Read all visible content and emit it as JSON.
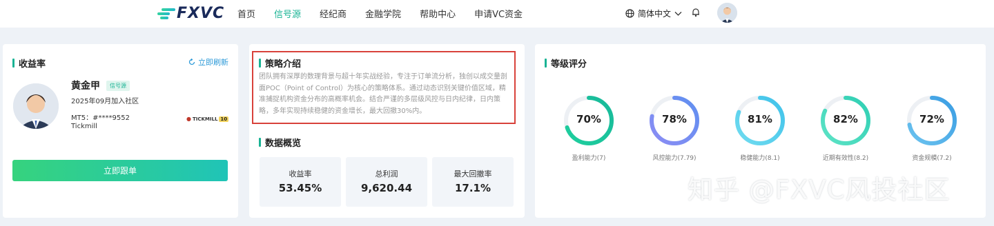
{
  "header": {
    "logo_text": "FXVC",
    "nav": [
      "首页",
      "信号源",
      "经纪商",
      "金融学院",
      "帮助中心",
      "申请VC资金"
    ],
    "active_nav": 1,
    "language": "简体中文",
    "accent": "#19b394"
  },
  "profile": {
    "section_title": "收益率",
    "refresh_label": "立即刷新",
    "name": "黄金甲",
    "badge": "信号源",
    "joined": "2025年09月加入社区",
    "mt5": "MT5：#****9552",
    "broker": "Tickmill",
    "broker_logo_text": "TICKMILL",
    "broker_logo_badge": "10",
    "follow_button": "立即跟单"
  },
  "strategy": {
    "title": "策略介绍",
    "description": "团队拥有深厚的数理背景与超十年实战经验，专注于订单流分析，独创以成交量剖面POC（Point of Control）为核心的策略体系。通过动态识别关键价值区域，精准捕捉机构资金分布的高概率机会。结合严谨的多层级风控与日内纪律，日内策略，多年实现持续稳健的资金增长，最大回撤30%内。"
  },
  "overview": {
    "title": "数据概览",
    "kpis": [
      {
        "label": "收益率",
        "value": "53.45%"
      },
      {
        "label": "总利润",
        "value": "9,620.44"
      },
      {
        "label": "最大回撤率",
        "value": "17.1%"
      }
    ]
  },
  "rating": {
    "title": "等级评分",
    "items": [
      {
        "percent": 70,
        "percent_text": "70%",
        "label": "盈利能力(7)",
        "colors": [
          "#1fcf9e",
          "#18b99a"
        ]
      },
      {
        "percent": 78,
        "percent_text": "78%",
        "label": "风控能力(7.79)",
        "colors": [
          "#8c8df4",
          "#5f8ff0"
        ]
      },
      {
        "percent": 81,
        "percent_text": "81%",
        "label": "稳健能力(8.1)",
        "colors": [
          "#71dcf0",
          "#3fc2ea"
        ]
      },
      {
        "percent": 82,
        "percent_text": "82%",
        "label": "近期有效性(8.2)",
        "colors": [
          "#5ee3c6",
          "#2fcfb3"
        ]
      },
      {
        "percent": 72,
        "percent_text": "72%",
        "label": "资金规模(7.2)",
        "colors": [
          "#6cc3ef",
          "#3a9de3"
        ]
      }
    ]
  },
  "watermark": "知乎 @FXVC风投社区"
}
